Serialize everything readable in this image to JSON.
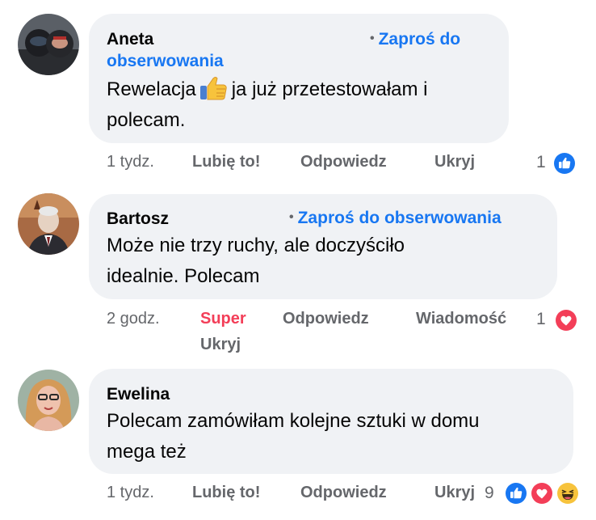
{
  "colors": {
    "link_blue": "#1877f2",
    "super_red": "#f33e58",
    "meta_gray": "#65676b",
    "bubble_bg": "#f0f2f5"
  },
  "comments": [
    {
      "author": "Aneta",
      "follow_label": "Zaproś do obserwowania",
      "follow_line1": "Zaproś do",
      "follow_line2": "obserwowania",
      "text_part1": "Rewelacja",
      "text_emoji": "thumbs-up-emoji",
      "text_part2": "ja już przetestowałam i",
      "text_line2": "polecam.",
      "time": "1 tydz.",
      "like": "Lubię to!",
      "reply": "Odpowiedz",
      "hide": "Ukryj",
      "reaction_count": "1",
      "reactions": [
        "like-reaction-icon"
      ]
    },
    {
      "author": "Bartosz",
      "follow_label": "Zaproś do obserwowania",
      "text_line1": "Może nie trzy ruchy, ale doczyściło",
      "text_line2": "idealnie. Polecam",
      "time": "2 godz.",
      "reaction_label": "Super",
      "reply": "Odpowiedz",
      "message": "Wiadomość",
      "hide": "Ukryj",
      "reaction_count": "1",
      "reactions": [
        "love-reaction-icon"
      ]
    },
    {
      "author": "Ewelina",
      "text_line1": "Polecam zamówiłam kolejne sztuki w domu",
      "text_line2": "mega też",
      "time": "1 tydz.",
      "like": "Lubię to!",
      "reply": "Odpowiedz",
      "hide": "Ukryj",
      "reaction_count": "9",
      "reactions": [
        "like-reaction-icon",
        "love-reaction-icon",
        "haha-reaction-icon"
      ]
    }
  ]
}
